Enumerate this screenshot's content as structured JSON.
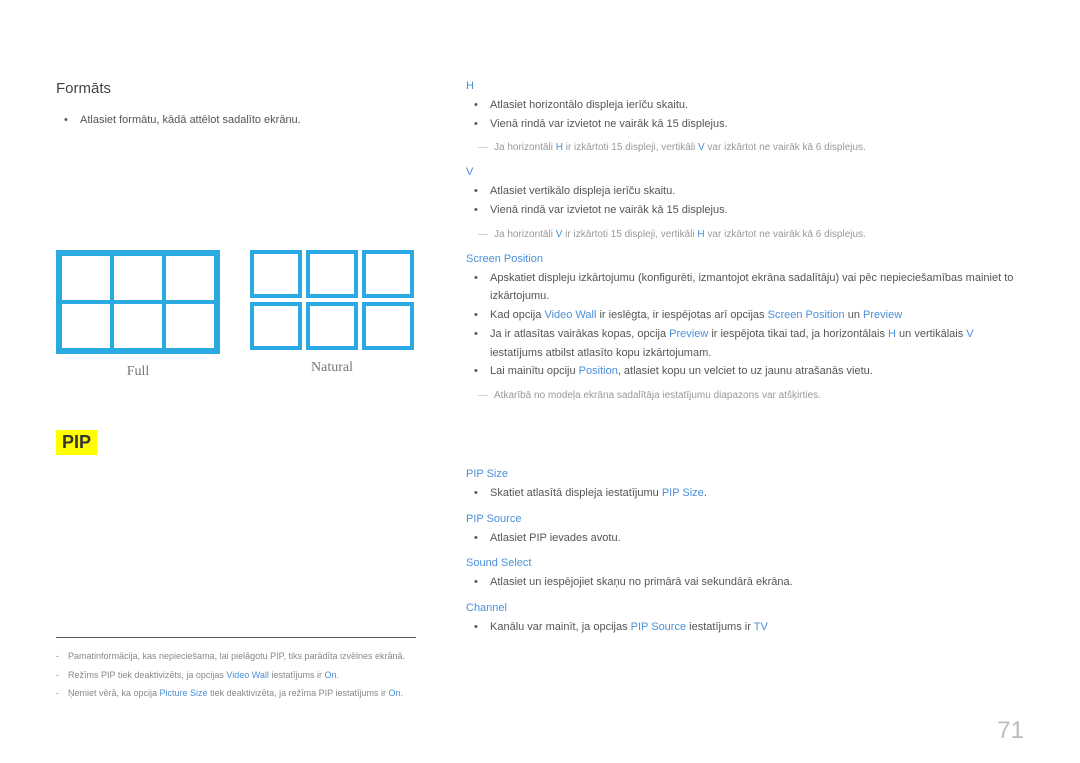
{
  "left": {
    "heading": "Formāts",
    "bullet1": "Atlasiet formātu, kādā attēlot sadalīto ekrānu.",
    "captionFull": "Full",
    "captionNatural": "Natural"
  },
  "pip_heading": "PIP",
  "footnotes": {
    "a": "Pamatinformācija, kas nepieciešama, lai pielāgotu PIP, tiks parādīta izvēlnes ekrānā.",
    "b_pre": "Režīms PIP tiek deaktivizēts, ja opcijas ",
    "b_vw": "Video Wall",
    "b_mid": " iestatījums ir ",
    "b_on": "On",
    "b_end": ".",
    "c_pre": "Ņemiet vērā, ka opcija ",
    "c_ps": "Picture Size",
    "c_mid": " tiek deaktivizēta, ja režīma PIP iestatījums ir ",
    "c_on": "On",
    "c_end": "."
  },
  "right": {
    "h_label": "H",
    "h_b1": "Atlasiet horizontālo displeja ierīču skaitu.",
    "h_b2": "Vienā rindā var izvietot ne vairāk kā 15 displejus.",
    "h_note_pre": "Ja horizontāli ",
    "h_note_mid1": " ir izkārtoti 15 displeji, vertikāli ",
    "h_note_mid2": " var izkārtot ne vairāk kā 6 displejus.",
    "v_label": "V",
    "v_b1": "Atlasiet vertikālo displeja ierīču skaitu.",
    "v_b2": "Vienā rindā var izvietot ne vairāk kā 15 displejus.",
    "v_note_pre": "Ja horizontāli ",
    "v_note_mid1": " ir izkārtoti 15 displeji, vertikāli ",
    "v_note_mid2": " var izkārtot ne vairāk kā 6 displejus.",
    "sp_label": "Screen Position",
    "sp_b1": "Apskatiet displeju izkārtojumu (konfigurēti, izmantojot ekrāna sadalītāju) vai pēc nepieciešamības mainiet to izkārtojumu.",
    "sp_b2_pre": "Kad opcija ",
    "sp_b2_vw": "Video Wall",
    "sp_b2_mid": " ir ieslēgta, ir iespējotas arī opcijas ",
    "sp_b2_sp": "Screen Position",
    "sp_b2_and": " un ",
    "sp_b2_pv": "Preview",
    "sp_b3_pre": "Ja ir atlasītas vairākas kopas, opcija ",
    "sp_b3_pv": "Preview",
    "sp_b3_mid1": " ir iespējota tikai tad, ja horizontālais ",
    "sp_b3_mid2": " un vertikālais ",
    "sp_b3_end": " iestatījums atbilst atlasīto kopu izkārtojumam.",
    "sp_b4_pre": "Lai mainītu opciju ",
    "sp_b4_pos": "Position",
    "sp_b4_end": ", atlasiet kopu un velciet to uz jaunu atrašanās vietu.",
    "sp_note": "Atkarībā no modeļa ekrāna sadalītāja iestatījumu diapazons var atšķirties.",
    "psize_label": "PIP Size",
    "psize_b_pre": "Skatiet atlasītā displeja iestatījumu ",
    "psize_b_blue": "PIP Size",
    "psize_b_end": ".",
    "psrc_label": "PIP Source",
    "psrc_b": "Atlasiet PIP ievades avotu.",
    "ss_label": "Sound Select",
    "ss_b": "Atlasiet un iespējojiet skaņu no primārā vai sekundārā ekrāna.",
    "ch_label": "Channel",
    "ch_b_pre": "Kanālu var mainīt, ja opcijas ",
    "ch_b_src": "PIP Source",
    "ch_b_mid": " iestatījums ir ",
    "ch_b_tv": "TV"
  },
  "page_number": "71"
}
